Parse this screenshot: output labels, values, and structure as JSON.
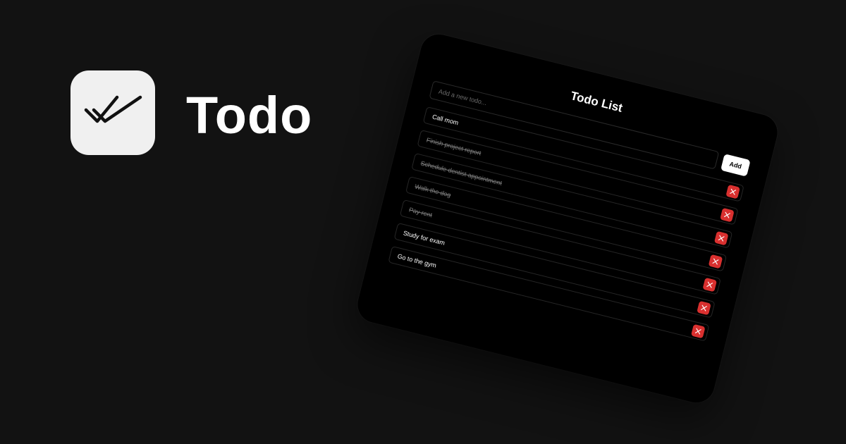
{
  "app": {
    "name": "Todo",
    "icon": "double-check-icon"
  },
  "colors": {
    "background": "#121212",
    "icon_tile": "#f0f0f0",
    "icon_stroke": "#111111",
    "title_text": "#ffffff",
    "card_background": "#000000",
    "card_text": "#ffffff",
    "done_text": "#7d7d7d",
    "add_button_bg": "#ffffff",
    "add_button_text": "#000000",
    "delete_button_bg": "#d9302f",
    "delete_icon": "#ffffff"
  },
  "todo_card": {
    "title": "Todo List",
    "input": {
      "placeholder": "Add a new todo...",
      "value": ""
    },
    "add_button_label": "Add",
    "items": [
      {
        "text": "Call mom",
        "completed": false
      },
      {
        "text": "Finish project report",
        "completed": true
      },
      {
        "text": "Schedule dentist appointment",
        "completed": true
      },
      {
        "text": "Walk the dog",
        "completed": true
      },
      {
        "text": "Pay rent",
        "completed": true
      },
      {
        "text": "Study for exam",
        "completed": false
      },
      {
        "text": "Go to the gym",
        "completed": false
      }
    ],
    "delete_icon": "close-icon"
  }
}
